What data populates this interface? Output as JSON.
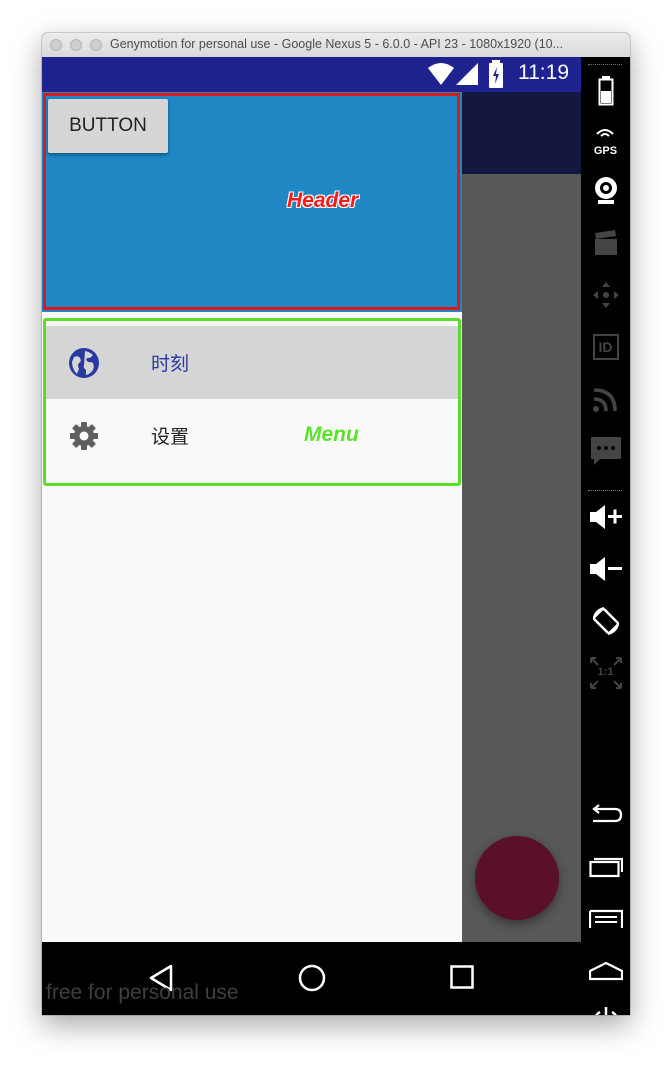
{
  "window": {
    "title": "Genymotion for personal use - Google Nexus 5 - 6.0.0 - API 23 - 1080x1920 (10..."
  },
  "statusbar": {
    "time": "11:19"
  },
  "drawer": {
    "header": {
      "button_label": "BUTTON",
      "annotation": "Header"
    },
    "menu": {
      "annotation": "Menu",
      "items": [
        {
          "label": "时刻",
          "icon": "globe-icon",
          "selected": true
        },
        {
          "label": "设置",
          "icon": "gear-icon",
          "selected": false
        }
      ]
    }
  },
  "watermark": "free for personal use",
  "sidebar": {
    "tools": [
      "battery-icon",
      "gps-icon",
      "webcam-icon",
      "media-icon",
      "dpad-icon",
      "id-icon",
      "network-icon",
      "sms-icon",
      "volume-up-icon",
      "volume-down-icon",
      "rotate-icon",
      "pixel-perfect-icon",
      "back-icon",
      "recents-icon",
      "menu-icon",
      "home-icon",
      "power-icon"
    ],
    "gps_label": "GPS",
    "id_label": "ID",
    "pixel_label": "1:1"
  },
  "colors": {
    "statusbar": "#1f2390",
    "appbar": "#141841",
    "header": "#1f87c4",
    "header_outline": "#e01818",
    "menu_outline": "#5bdc2a",
    "fab": "#5a1029",
    "selected_item_text": "#2a38a4"
  }
}
